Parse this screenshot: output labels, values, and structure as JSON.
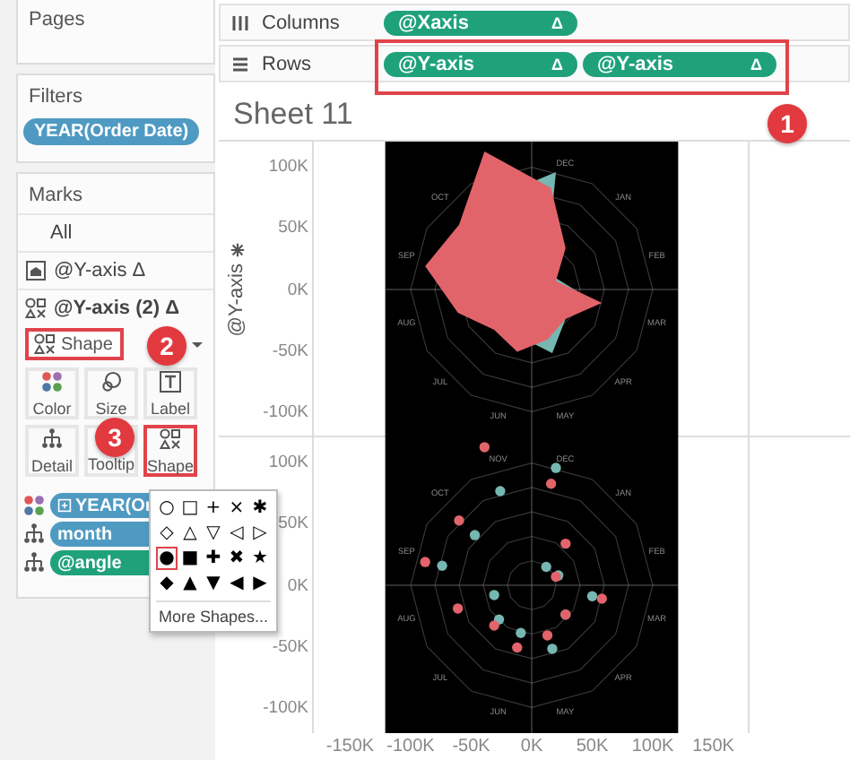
{
  "shelves": [
    {
      "label": "Columns",
      "kind": "columns",
      "highlighted": false,
      "pills": [
        {
          "label": "@Xaxis",
          "delta": "Δ"
        }
      ]
    },
    {
      "label": "Rows",
      "kind": "rows",
      "highlighted": true,
      "badge": "1",
      "pills": [
        {
          "label": "@Y-axis",
          "delta": "Δ"
        },
        {
          "label": "@Y-axis",
          "delta": "Δ"
        }
      ]
    }
  ],
  "sidebar": {
    "pages": {
      "title": "Pages"
    },
    "filters": {
      "title": "Filters",
      "pills": [
        {
          "label": "YEAR(Order Date)",
          "color": "#4f9ac2"
        }
      ]
    },
    "marks": {
      "title": "Marks",
      "layers": [
        {
          "label": "All",
          "kind": "all",
          "selected": false
        },
        {
          "label": "@Y-axis Δ",
          "kind": "area",
          "selected": false
        },
        {
          "label": "@Y-axis (2) Δ",
          "kind": "shape",
          "selected": true
        }
      ],
      "mark_type": {
        "label": "Shape",
        "highlighted": true,
        "badge": "2"
      },
      "properties": [
        {
          "label": "Color",
          "kind": "color",
          "highlighted": false
        },
        {
          "label": "Size",
          "kind": "size",
          "highlighted": false
        },
        {
          "label": "Label",
          "kind": "label",
          "highlighted": false
        },
        {
          "label": "Detail",
          "kind": "detail",
          "highlighted": false
        },
        {
          "label": "Tooltip",
          "kind": "tooltip",
          "highlighted": false
        },
        {
          "label": "Shape",
          "kind": "shape",
          "highlighted": true,
          "badge": "3"
        }
      ],
      "fields": [
        {
          "label": "YEAR(Or",
          "kind": "color",
          "color": "#4f9ac2"
        },
        {
          "label": "month",
          "kind": "detail",
          "color": "#4f9ac2"
        },
        {
          "label": "@angle",
          "kind": "detail",
          "color": "#1fa27a"
        }
      ]
    }
  },
  "shape_popup": {
    "shapes": [
      {
        "glyph": "○",
        "selected": false
      },
      {
        "glyph": "□",
        "selected": false
      },
      {
        "glyph": "+",
        "selected": false
      },
      {
        "glyph": "×",
        "selected": false
      },
      {
        "glyph": "✱",
        "selected": false
      },
      {
        "glyph": "◇",
        "selected": false
      },
      {
        "glyph": "△",
        "selected": false
      },
      {
        "glyph": "▽",
        "selected": false
      },
      {
        "glyph": "◁",
        "selected": false
      },
      {
        "glyph": "▷",
        "selected": false
      },
      {
        "glyph": "●",
        "selected": true
      },
      {
        "glyph": "■",
        "selected": false
      },
      {
        "glyph": "✚",
        "selected": false
      },
      {
        "glyph": "✖",
        "selected": false
      },
      {
        "glyph": "★",
        "selected": false
      },
      {
        "glyph": "◆",
        "selected": false
      },
      {
        "glyph": "▲",
        "selected": false
      },
      {
        "glyph": "▼",
        "selected": false
      },
      {
        "glyph": "◀",
        "selected": false
      },
      {
        "glyph": "▶",
        "selected": false
      }
    ],
    "more": "More Shapes..."
  },
  "sheet": {
    "title": "Sheet 11",
    "y_axis_title": "@Y-axis",
    "panels": [
      {
        "kind": "radar",
        "y_ticks": [
          "100K",
          "50K",
          "0K",
          "-50K",
          "-100K"
        ],
        "grid_labels": [
          "DEC",
          "JAN",
          "FEB",
          "MAR",
          "APR",
          "MAY",
          "JUN",
          "JUL",
          "AUG",
          "SEP",
          "OCT"
        ]
      },
      {
        "kind": "dots",
        "y_ticks": [
          "100K",
          "50K",
          "0K",
          "-50K",
          "-100K"
        ],
        "grid_labels": [
          "DEC",
          "JAN",
          "FEB",
          "MAR",
          "APR",
          "MAY",
          "JUN",
          "JUL",
          "AUG",
          "SEP",
          "OCT",
          "NOV"
        ]
      }
    ],
    "x_ticks": [
      "-150K",
      "-100K",
      "-50K",
      "0K",
      "50K",
      "100K",
      "150K"
    ]
  }
}
